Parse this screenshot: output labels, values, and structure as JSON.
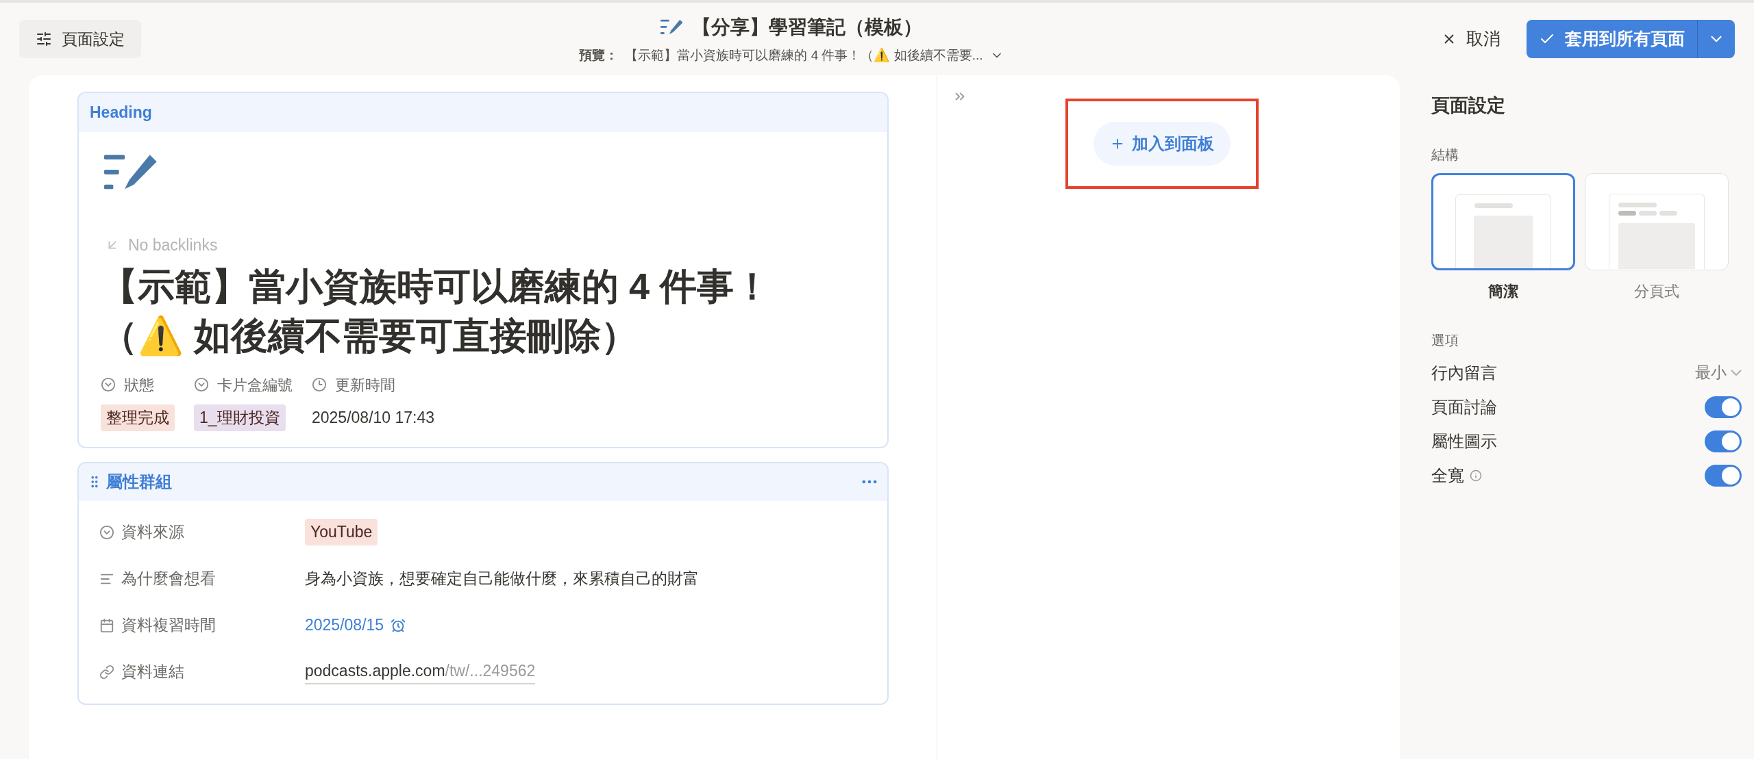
{
  "topbar": {
    "settings_button": "頁面設定",
    "title": "【分享】學習筆記（模板）",
    "preview_label": "預覽：",
    "preview_text": "【示範】當小資族時可以磨練的 4 件事！（⚠️ 如後續不需要...",
    "cancel": "取消",
    "apply": "套用到所有頁面"
  },
  "heading_section": {
    "label": "Heading",
    "backlinks": "No backlinks",
    "page_title": "【示範】當小資族時可以磨練的 4 件事！（⚠️ 如後續不需要可直接刪除）",
    "properties": [
      {
        "kind": "select",
        "name": "狀態",
        "value": "整理完成",
        "color": "#f9e1dc"
      },
      {
        "kind": "select",
        "name": "卡片盒編號",
        "value": "1_理財投資",
        "color": "#e8deee"
      },
      {
        "kind": "time",
        "name": "更新時間",
        "value": "2025/08/10 17:43"
      }
    ]
  },
  "property_group": {
    "title": "屬性群組",
    "rows": [
      {
        "kind": "select",
        "name": "資料來源",
        "value": "YouTube",
        "color": "#f9e1dc"
      },
      {
        "kind": "text",
        "name": "為什麼會想看",
        "value": "身為小資族，想要確定自己能做什麼，來累積自己的財富"
      },
      {
        "kind": "date",
        "name": "資料複習時間",
        "value": "2025/08/15"
      },
      {
        "kind": "url",
        "name": "資料連結",
        "value": "podcasts.apple.com",
        "value_tail": "/tw/...249562"
      }
    ]
  },
  "panel": {
    "add_button": "加入到面板",
    "highlighted": true
  },
  "settings": {
    "title": "頁面設定",
    "structure_label": "結構",
    "layouts": [
      {
        "kind": "simple",
        "label": "簡潔",
        "selected": true
      },
      {
        "kind": "tabbed",
        "label": "分頁式",
        "selected": false
      }
    ],
    "options_label": "選項",
    "options": [
      {
        "kind": "dropdown",
        "label": "行內留言",
        "value": "最小"
      },
      {
        "kind": "toggle",
        "label": "頁面討論",
        "on": true
      },
      {
        "kind": "toggle",
        "label": "屬性圖示",
        "on": true
      },
      {
        "kind": "toggle",
        "label": "全寬",
        "info": true,
        "on": true
      }
    ]
  }
}
